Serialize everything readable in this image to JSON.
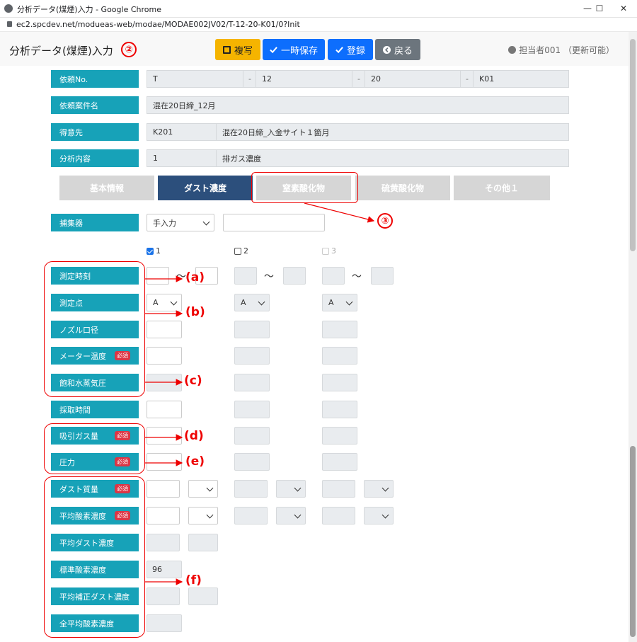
{
  "window": {
    "title": "分析データ(煤煙)入力 - Google Chrome",
    "min": "—",
    "max": "☐",
    "close": "✕"
  },
  "address": {
    "url": "ec2.spcdev.net/modueas-web/modae/MODAE002JV02/T-12-20-K01/0?Init"
  },
  "header": {
    "title": "分析データ(煤煙)入力",
    "copy_label": "複写",
    "save_temp_label": "一時保存",
    "register_label": "登録",
    "back_label": "戻る",
    "user": "担当者001 （更新可能）"
  },
  "info": {
    "request_no_label": "依頼No.",
    "request_no": [
      "T",
      "12",
      "20",
      "K01"
    ],
    "request_no_sep": "-",
    "case_name_label": "依頼案件名",
    "case_name": "混在20日締_12月",
    "client_label": "得意先",
    "client_code": "K201",
    "client_name": "混在20日締_入金サイト１箇月",
    "analysis_label": "分析内容",
    "analysis_code": "1",
    "analysis_name": "排ガス濃度"
  },
  "tabs": [
    "基本情報",
    "ダスト濃度",
    "窒素酸化物",
    "硫黄酸化物",
    "その他１"
  ],
  "collector": {
    "label": "捕集器",
    "value": "手入力"
  },
  "columns": [
    {
      "label": "1",
      "checked": true,
      "enabled": true
    },
    {
      "label": "2",
      "checked": false,
      "enabled": true
    },
    {
      "label": "3",
      "checked": false,
      "enabled": false
    }
  ],
  "rows": {
    "time": "測定時刻",
    "point": "測定点",
    "nozzle": "ノズル口径",
    "meter_temp": "メーター温度",
    "vapor": "飽和水蒸気圧",
    "sampling_time": "採取時間",
    "gas_volume": "吸引ガス量",
    "pressure": "圧力",
    "dust_mass": "ダスト質量",
    "avg_o2": "平均酸素濃度",
    "avg_dust": "平均ダスト濃度",
    "std_o2": "標準酸素濃度",
    "avg_corr_dust": "平均補正ダスト濃度",
    "total_avg_o2": "全平均酸素濃度"
  },
  "required_badge": "必須",
  "tilde": "～",
  "point_option": "A",
  "std_o2_value": "96",
  "annotations": {
    "n2": "②",
    "n3": "③",
    "a": "(a)",
    "b": "(b)",
    "c": "(c)",
    "d": "(d)",
    "e": "(e)",
    "f": "(f)"
  },
  "colors": {
    "label_bg": "#17a2b8",
    "active_tab": "#2c4f7c",
    "annotation": "#e00000",
    "required": "#dc3545"
  }
}
